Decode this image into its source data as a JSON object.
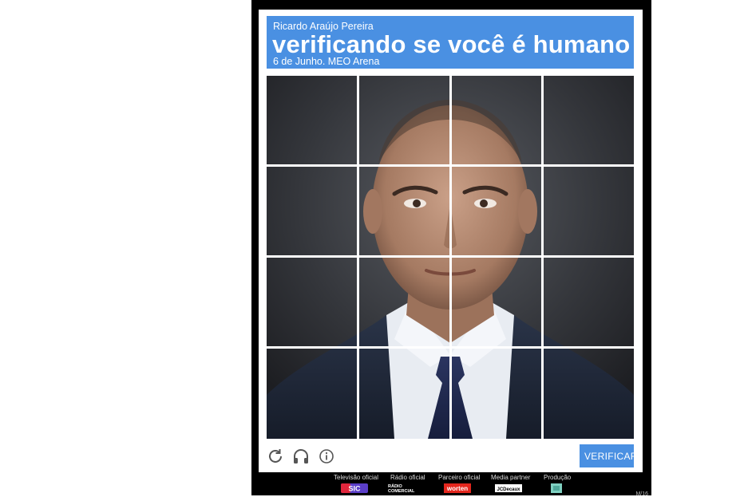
{
  "header": {
    "name": "Ricardo Araújo Pereira",
    "title": "verificando se você é humano",
    "date": "6 de Junho. MEO Arena"
  },
  "controls": {
    "reload_icon": "reload-icon",
    "audio_icon": "headphones-icon",
    "info_icon": "info-icon",
    "verify_label": "VERIFICAR"
  },
  "sponsors": [
    {
      "label": "Televisão oficial",
      "logo": "SIC"
    },
    {
      "label": "Rádio oficial",
      "logo": "RÁDIO COMERCIAL"
    },
    {
      "label": "Parceiro oficial",
      "logo": "worten"
    },
    {
      "label": "Media partner",
      "logo": "JCDecaux"
    },
    {
      "label": "Produção",
      "logo": ""
    }
  ],
  "page_number": "M/16",
  "colors": {
    "accent": "#4a90e2",
    "background": "#000000",
    "card": "#ffffff"
  }
}
